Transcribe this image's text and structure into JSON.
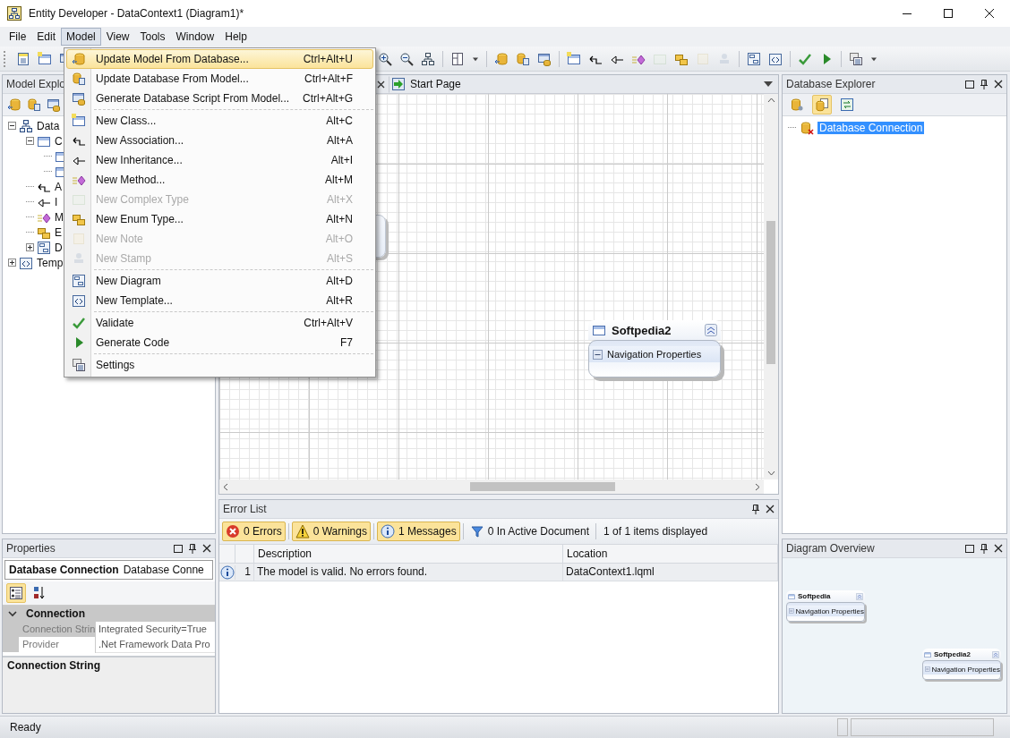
{
  "window": {
    "title": "Entity Developer - DataContext1 (Diagram1)*"
  },
  "menubar": [
    {
      "label": "File",
      "selected": false
    },
    {
      "label": "Edit",
      "selected": false
    },
    {
      "label": "Model",
      "selected": true
    },
    {
      "label": "View",
      "selected": false
    },
    {
      "label": "Tools",
      "selected": false
    },
    {
      "label": "Window",
      "selected": false
    },
    {
      "label": "Help",
      "selected": false
    }
  ],
  "toolbar_left": [
    {
      "kind": "button",
      "disabled": false
    },
    {
      "kind": "button",
      "disabled": false
    },
    {
      "kind": "button",
      "disabled": false
    }
  ],
  "toolbar_right": [
    {
      "kind": "button",
      "disabled": false
    },
    {
      "kind": "button",
      "disabled": false
    },
    {
      "kind": "button",
      "disabled": false
    },
    {
      "kind": "separator"
    },
    {
      "kind": "button",
      "disabled": false
    },
    {
      "kind": "dropdown",
      "disabled": false
    },
    {
      "kind": "separator"
    },
    {
      "kind": "button",
      "disabled": false
    },
    {
      "kind": "button",
      "disabled": false
    },
    {
      "kind": "button",
      "disabled": false
    },
    {
      "kind": "separator"
    },
    {
      "kind": "button",
      "disabled": false
    },
    {
      "kind": "button",
      "disabled": false
    },
    {
      "kind": "button",
      "disabled": false
    },
    {
      "kind": "button",
      "disabled": false
    },
    {
      "kind": "button",
      "disabled": true
    },
    {
      "kind": "button",
      "disabled": false
    },
    {
      "kind": "button",
      "disabled": true
    },
    {
      "kind": "button",
      "disabled": true
    },
    {
      "kind": "separator"
    },
    {
      "kind": "button",
      "disabled": false
    },
    {
      "kind": "button",
      "disabled": false
    },
    {
      "kind": "separator"
    },
    {
      "kind": "button",
      "disabled": false
    },
    {
      "kind": "button",
      "disabled": false
    },
    {
      "kind": "separator"
    },
    {
      "kind": "button",
      "disabled": false
    },
    {
      "kind": "dropdown",
      "disabled": false
    }
  ],
  "model_menu": {
    "groups": [
      [
        {
          "label": "Update Model From Database...",
          "shortcut": "Ctrl+Alt+U",
          "disabled": false,
          "selected": true
        },
        {
          "label": "Update Database From Model...",
          "shortcut": "Ctrl+Alt+F",
          "disabled": false,
          "selected": false
        },
        {
          "label": "Generate Database Script From Model...",
          "shortcut": "Ctrl+Alt+G",
          "disabled": false,
          "selected": false
        }
      ],
      [
        {
          "label": "New Class...",
          "shortcut": "Alt+C",
          "disabled": false,
          "selected": false
        },
        {
          "label": "New Association...",
          "shortcut": "Alt+A",
          "disabled": false,
          "selected": false
        },
        {
          "label": "New Inheritance...",
          "shortcut": "Alt+I",
          "disabled": false,
          "selected": false
        },
        {
          "label": "New Method...",
          "shortcut": "Alt+M",
          "disabled": false,
          "selected": false
        },
        {
          "label": "New Complex Type",
          "shortcut": "Alt+X",
          "disabled": true,
          "selected": false
        },
        {
          "label": "New Enum Type...",
          "shortcut": "Alt+N",
          "disabled": false,
          "selected": false
        },
        {
          "label": "New Note",
          "shortcut": "Alt+O",
          "disabled": true,
          "selected": false
        },
        {
          "label": "New Stamp",
          "shortcut": "Alt+S",
          "disabled": true,
          "selected": false
        }
      ],
      [
        {
          "label": "New Diagram",
          "shortcut": "Alt+D",
          "disabled": false,
          "selected": false
        },
        {
          "label": "New Template...",
          "shortcut": "Alt+R",
          "disabled": false,
          "selected": false
        }
      ],
      [
        {
          "label": "Validate",
          "shortcut": "Ctrl+Alt+V",
          "disabled": false,
          "selected": false
        },
        {
          "label": "Generate Code",
          "shortcut": "F7",
          "disabled": false,
          "selected": false
        }
      ],
      [
        {
          "label": "Settings",
          "disabled": false,
          "selected": false
        }
      ]
    ]
  },
  "model_explorer": {
    "title": "Model Explo",
    "tree": [
      {
        "kind": "model",
        "label": "Data",
        "expanded": true,
        "children": [
          {
            "kind": "classes",
            "label": "C",
            "expanded": true,
            "children": [
              {
                "kind": "class"
              },
              {
                "kind": "class"
              }
            ]
          },
          {
            "kind": "associations",
            "label": "A"
          },
          {
            "kind": "inheritances",
            "label": "I"
          },
          {
            "kind": "methods",
            "label": "M"
          },
          {
            "kind": "enums",
            "label": "E"
          },
          {
            "kind": "diagrams",
            "label": "D",
            "expanded": false
          }
        ]
      },
      {
        "kind": "templates",
        "label": "Temp",
        "expanded": false
      }
    ]
  },
  "doc_tabs": [
    {
      "label": "Start Page",
      "selected": false
    }
  ],
  "diagram": {
    "entities": [
      {
        "name": "Softpedia2",
        "section": "Navigation Properties"
      }
    ]
  },
  "database_explorer": {
    "title": "Database Explorer",
    "tools": [
      {
        "on": false
      },
      {
        "on": true
      },
      {
        "on": false
      }
    ],
    "tree": [
      {
        "label": "Database Connection",
        "selected": true
      }
    ]
  },
  "properties": {
    "title": "Properties",
    "object_name": "Database Connection",
    "object_type": "Database Conne",
    "view_modes": [
      {
        "selected": true
      },
      {
        "selected": false
      }
    ],
    "categories": [
      {
        "label": "Connection",
        "expanded": true,
        "rows": [
          {
            "name": "Connection Strin",
            "value": "Integrated Security=True",
            "selected": true
          },
          {
            "name": "Provider",
            "value": ".Net Framework Data Pro",
            "selected": false
          }
        ]
      }
    ],
    "description_title": "Connection String"
  },
  "error_list": {
    "title": "Error List",
    "filters": [
      {
        "kind": "error",
        "label": "0 Errors",
        "on": true
      },
      {
        "kind": "warning",
        "label": "0 Warnings",
        "on": true
      },
      {
        "kind": "message",
        "label": "1 Messages",
        "on": true
      }
    ],
    "scope": "0 In Active Document",
    "count": "1 of 1 items displayed",
    "columns": [
      "Description",
      "Location"
    ],
    "rows": [
      {
        "kind": "message",
        "number": "1",
        "description": "The model is valid. No errors found.",
        "location": "DataContext1.lqml"
      }
    ]
  },
  "diagram_overview": {
    "title": "Diagram Overview",
    "entities": [
      {
        "name": "Softpedia",
        "section": "Navigation Properties"
      },
      {
        "name": "Softpedia2",
        "section": "Navigation Properties"
      }
    ]
  },
  "status_bar": {
    "text": "Ready"
  }
}
